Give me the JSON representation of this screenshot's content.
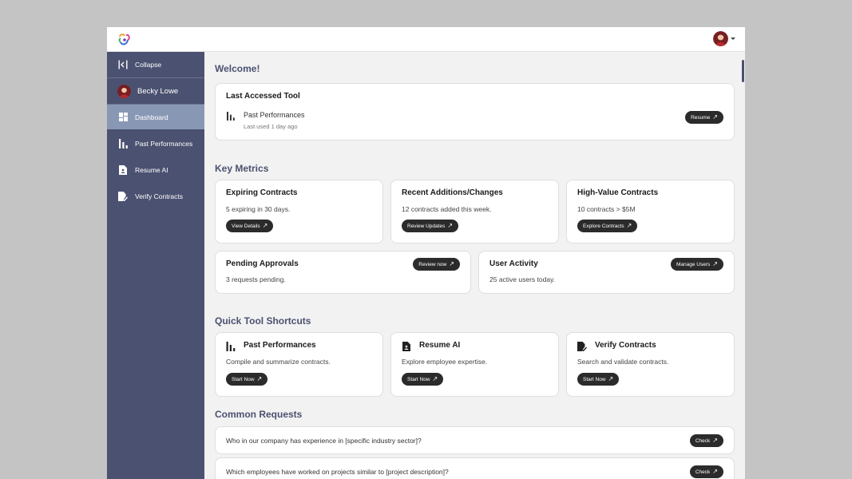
{
  "header": {
    "logo_icon": "colorful-logo-icon",
    "avatar_icon": "user-avatar"
  },
  "sidebar": {
    "collapse_label": "Collapse",
    "user_name": "Becky Lowe",
    "items": [
      {
        "label": "Dashboard",
        "icon": "dashboard-icon",
        "active": true
      },
      {
        "label": "Past Performances",
        "icon": "bar-chart-icon",
        "active": false
      },
      {
        "label": "Resume AI",
        "icon": "document-icon",
        "active": false
      },
      {
        "label": "Verify Contracts",
        "icon": "verify-document-icon",
        "active": false
      }
    ]
  },
  "welcome": "Welcome!",
  "last_accessed": {
    "title": "Last Accessed Tool",
    "tool_name": "Past Performances",
    "last_used": "Last used 1 day ago",
    "button": "Resume"
  },
  "key_metrics": {
    "title": "Key Metrics",
    "cards": [
      {
        "title": "Expiring Contracts",
        "text": "5 expiring in 30 days.",
        "button": "View Details"
      },
      {
        "title": "Recent Additions/Changes",
        "text": "12 contracts added this week.",
        "button": "Review Updates"
      },
      {
        "title": "High-Value Contracts",
        "text": "10 contracts > $5M",
        "button": "Explore Contracts"
      },
      {
        "title": "Pending Approvals",
        "text": "3 requests pending.",
        "button": "Review now"
      },
      {
        "title": "User Activity",
        "text": "25 active users today.",
        "button": "Manage Users"
      }
    ]
  },
  "quick_tools": {
    "title": "Quick Tool Shortcuts",
    "cards": [
      {
        "title": "Past Performances",
        "text": "Compile and summarize contracts.",
        "button": "Start Now",
        "icon": "bar-chart-icon"
      },
      {
        "title": "Resume AI",
        "text": "Explore employee expertise.",
        "button": "Start Now",
        "icon": "document-icon"
      },
      {
        "title": "Verify Contracts",
        "text": "Search and validate contracts.",
        "button": "Start Now",
        "icon": "verify-document-icon"
      }
    ]
  },
  "common_requests": {
    "title": "Common Requests",
    "items": [
      {
        "text": "Who in our company has experience in [specific industry sector]?",
        "button": "Check"
      },
      {
        "text": "Which employees have worked on projects similar to [project description]?",
        "button": "Check"
      }
    ]
  },
  "colors": {
    "sidebar": "#4b5170",
    "sidebar_active": "#8898b4",
    "heading": "#4b5170",
    "button": "#2b2b2b"
  }
}
